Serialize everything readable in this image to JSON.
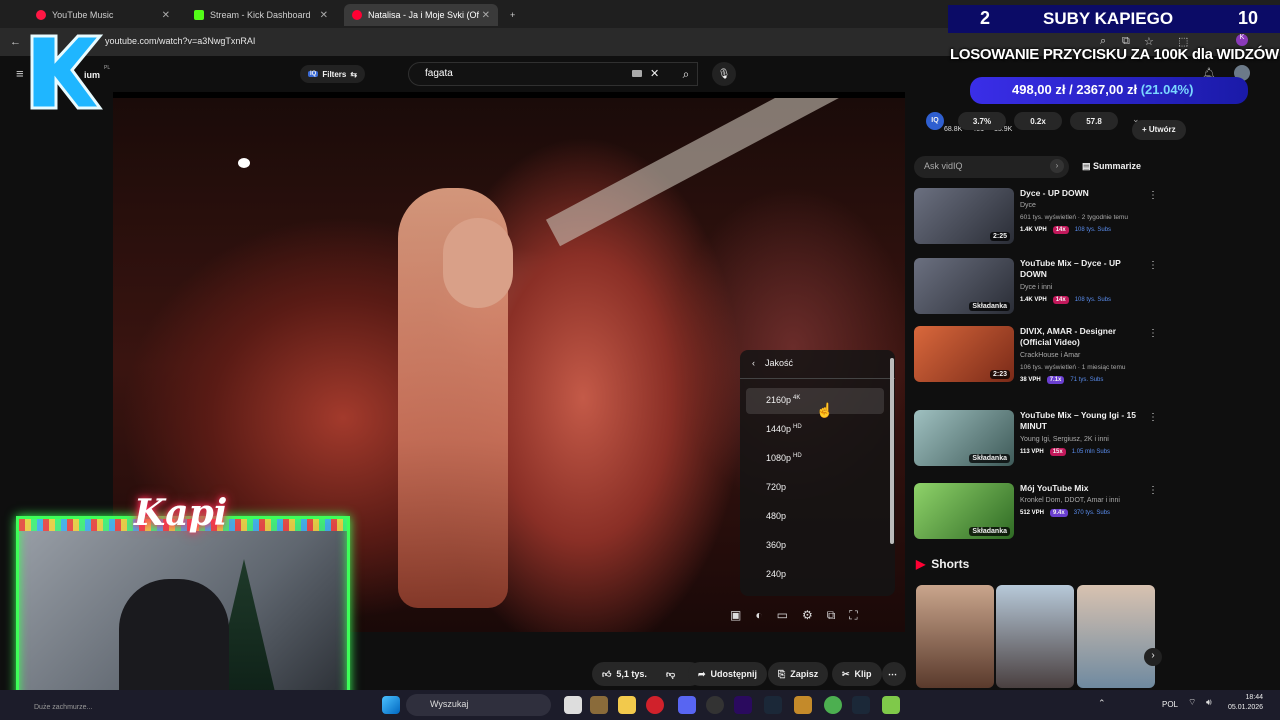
{
  "browser": {
    "tabs": [
      {
        "label": "YouTube Music",
        "active": false
      },
      {
        "label": "Stream - Kick Dashboard",
        "active": false
      },
      {
        "label": "Natalisa - Ja i Moje Svki (Of",
        "active": true
      }
    ],
    "url": "youtube.com/watch?v=a3NwgTxnRAI",
    "new_tab": "+"
  },
  "youtube": {
    "logo_fragment": "ium",
    "logo_region": "PL",
    "filters_label": "Filters",
    "search_value": "fagata",
    "create_label": "Utwórz",
    "stats": [
      "68.8K",
      "451",
      "15.9K"
    ]
  },
  "quality_menu": {
    "title": "Jakość",
    "items": [
      {
        "label": "2160p",
        "tag": "4K"
      },
      {
        "label": "1440p",
        "tag": "HD"
      },
      {
        "label": "1080p",
        "tag": "HD"
      },
      {
        "label": "720p",
        "tag": ""
      },
      {
        "label": "480p",
        "tag": ""
      },
      {
        "label": "360p",
        "tag": ""
      },
      {
        "label": "240p",
        "tag": ""
      }
    ]
  },
  "actions": {
    "likes": "5,1 tys.",
    "share": "Udostępnij",
    "save": "Zapisz",
    "clip": "Klip"
  },
  "vidiq": {
    "pills": [
      "3.7%",
      "0.2x",
      "57.8"
    ],
    "ask_placeholder": "Ask vidIQ",
    "summarize": "Summarize"
  },
  "recommendations": [
    {
      "title": "Dyce - UP DOWN",
      "channel": "Dyce",
      "meta": "601 tys. wyświetleń · 2 tygodnie temu",
      "vph": "1.4K VPH",
      "mult": "14x",
      "subs": "108 tys. Subs",
      "badge": "2:25",
      "color": "#3b3f4a"
    },
    {
      "title": "YouTube Mix – Dyce - UP DOWN",
      "channel": "Dyce i inni",
      "meta": "",
      "vph": "1.4K VPH",
      "mult": "14x",
      "subs": "108 tys. Subs",
      "badge": "Składanka",
      "color": "#3b3f4a"
    },
    {
      "title": "DIVIX, AMAR - Designer (Official Video)",
      "channel": "CrackHouse i Amar",
      "meta": "106 tys. wyświetleń · 1 miesiąc temu",
      "vph": "38 VPH",
      "mult": "7.1x",
      "subs": "71 tys. Subs",
      "badge": "2:23",
      "color": "#b0462a"
    },
    {
      "title": "YouTube Mix – Young Igi - 15 MINUT",
      "channel": "Young Igi, Sergiusz, 2K i inni",
      "meta": "",
      "vph": "113 VPH",
      "mult": "15x",
      "subs": "1.05 mln Subs",
      "badge": "Składanka",
      "color": "#6f8b8a"
    },
    {
      "title": "Mój YouTube Mix",
      "channel": "Kronkel Dom, DDOT, Amar i inni",
      "meta": "",
      "vph": "512 VPH",
      "mult": "9.4x",
      "subs": "370 tys. Subs",
      "badge": "Składanka",
      "color": "#4f8a3c"
    }
  ],
  "shorts_title": "Shorts",
  "overlay": {
    "count_left": "2",
    "label": "SUBY KAPIEGO",
    "count_right": "10",
    "line": "LOSOWANIE PRZYCISKU ZA 100K dla WIDZÓW",
    "raised": "498,00 zł",
    "goal": "2367,00 zł",
    "percent": "(21.04%)",
    "progress_fraction": 0.2104,
    "cam_name": "Kapi"
  },
  "taskbar": {
    "search": "Wyszukaj",
    "lang": "POL",
    "time": "18:44",
    "date": "05.01.2026",
    "hint": "Duże zachmurze..."
  }
}
